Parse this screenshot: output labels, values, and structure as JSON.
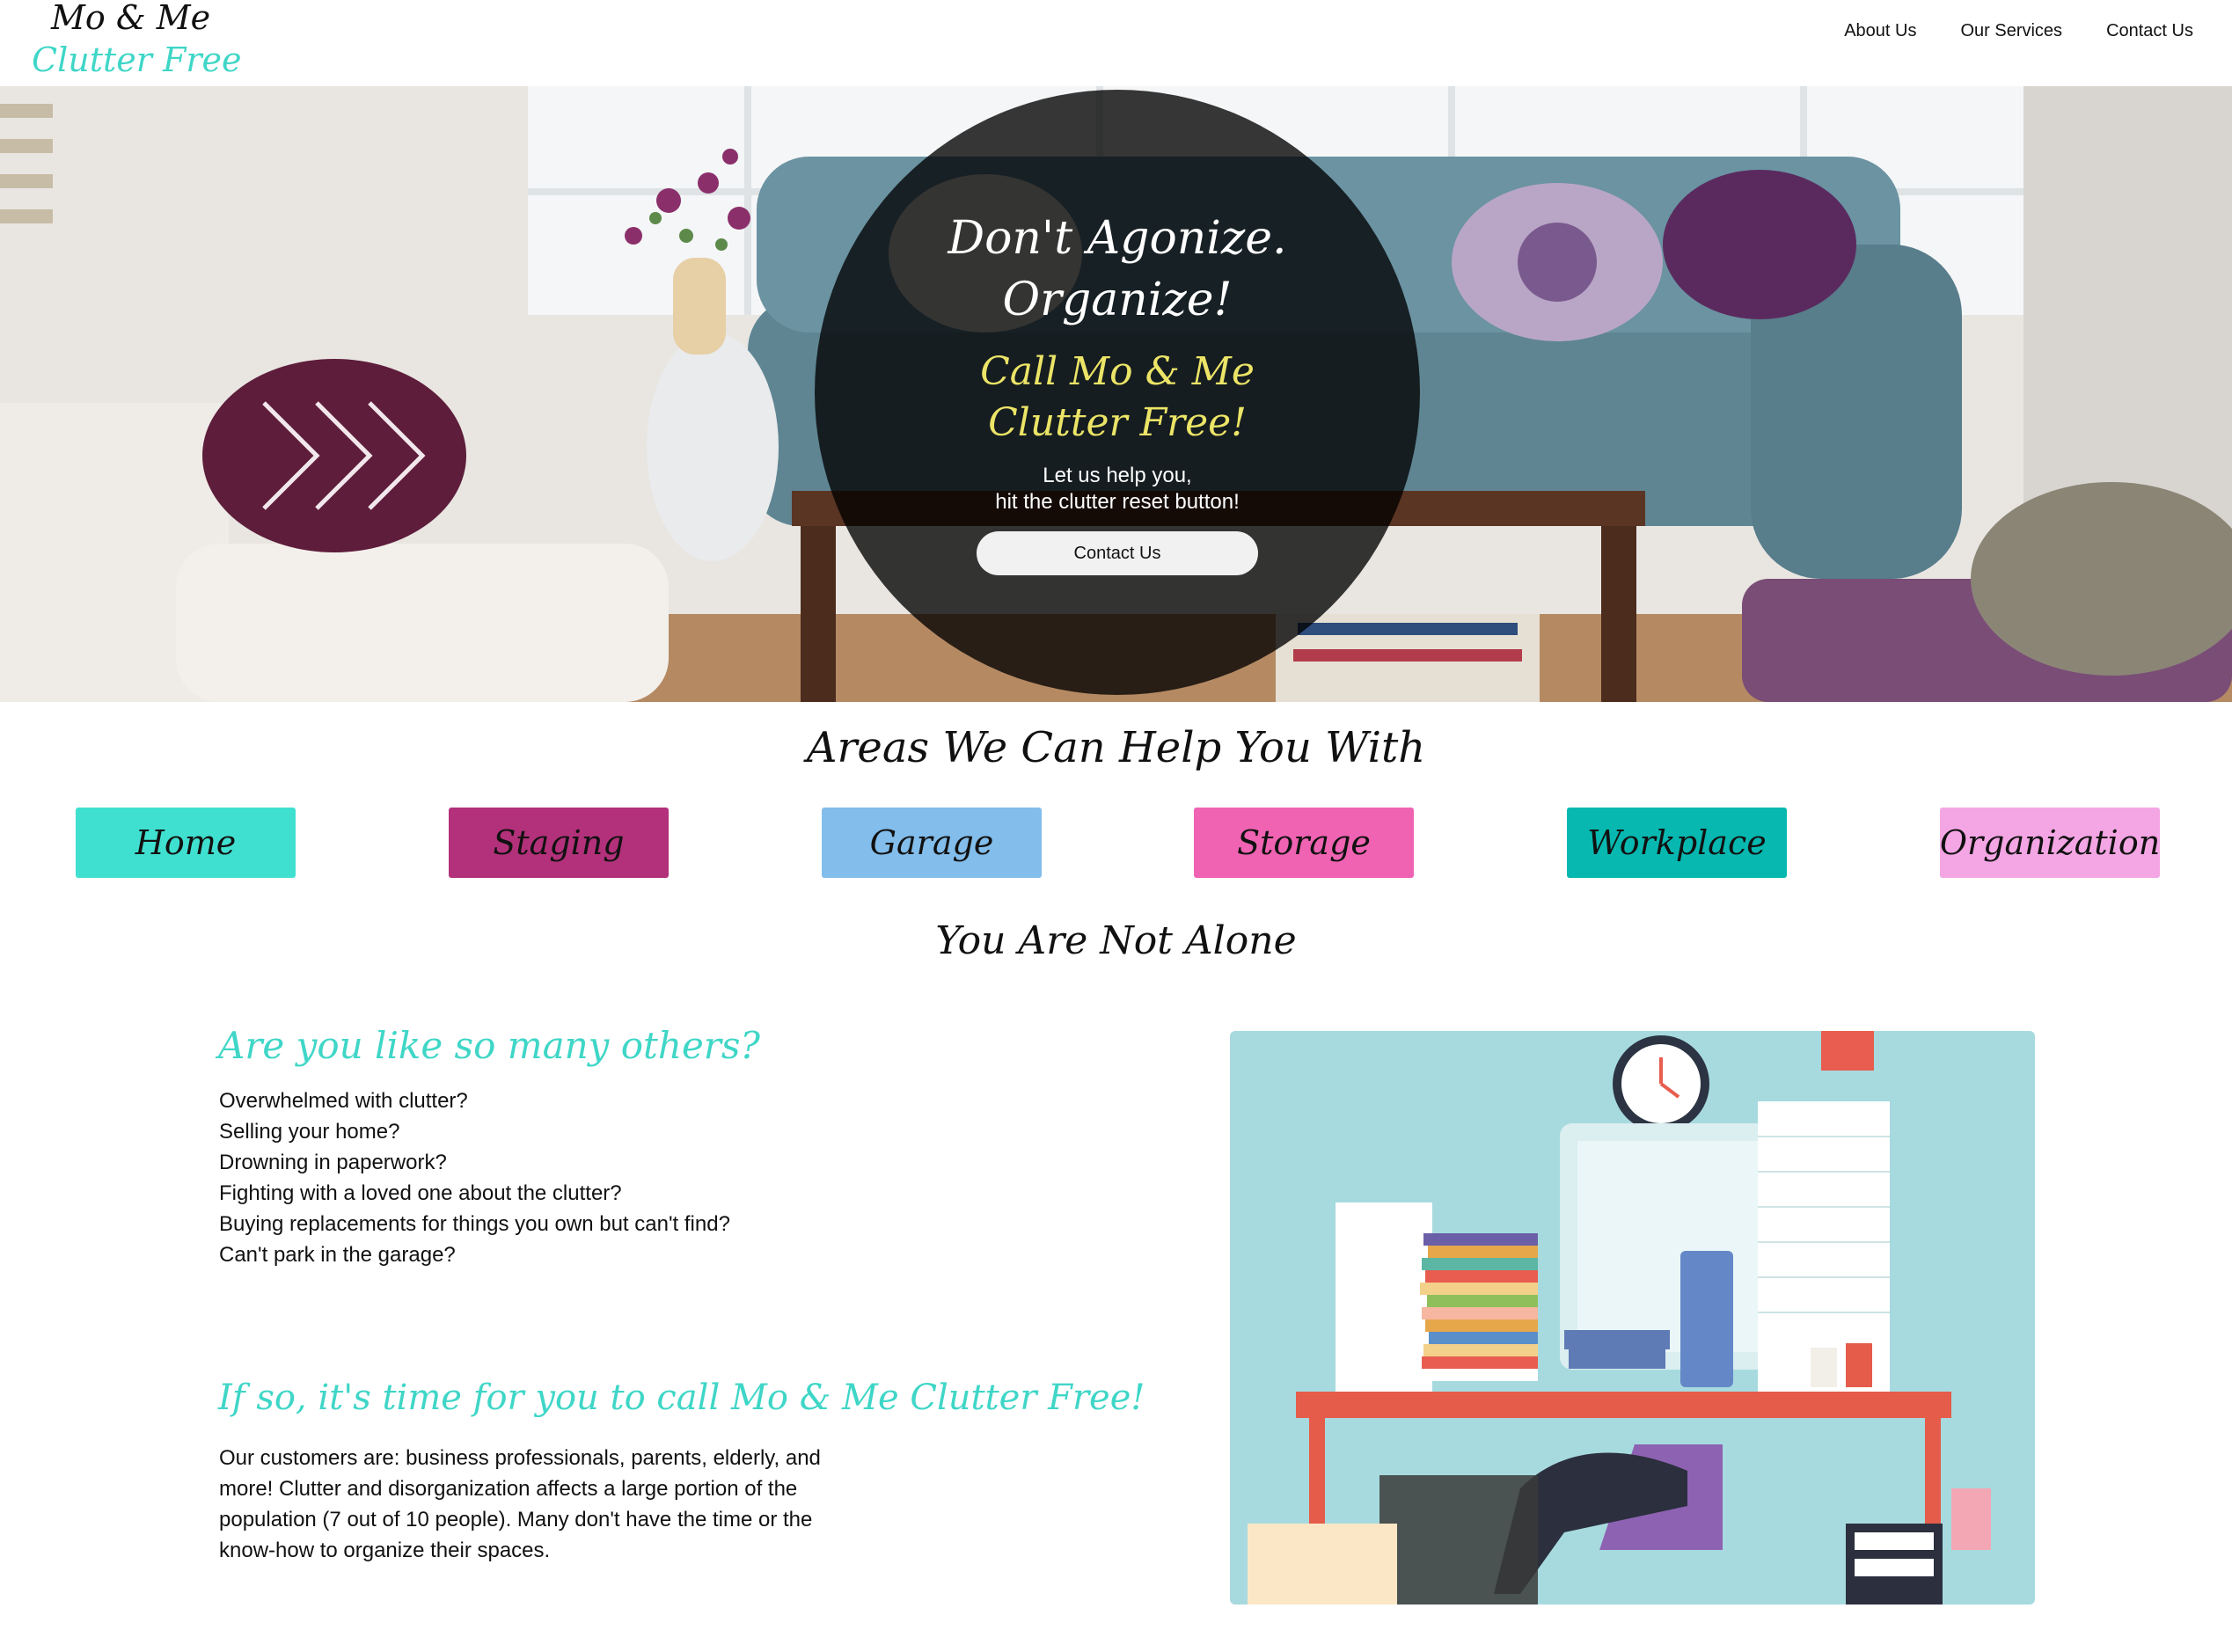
{
  "logo": {
    "line1": "Mo & Me",
    "line2": "Clutter Free"
  },
  "nav": {
    "items": [
      "About Us",
      "Our Services",
      "Contact Us"
    ]
  },
  "hero": {
    "title_line1": "Don't Agonize.",
    "title_line2": "Organize!",
    "call_line1": "Call Mo & Me",
    "call_line2": "Clutter Free!",
    "sub_line1": "Let us help you,",
    "sub_line2": "hit the clutter reset button!",
    "button_label": "Contact Us"
  },
  "areas": {
    "title": "Areas We Can Help You With",
    "items": [
      {
        "label": "Home",
        "color": "#40e0d0"
      },
      {
        "label": "Staging",
        "color": "#b2317a"
      },
      {
        "label": "Garage",
        "color": "#82bdeb"
      },
      {
        "label": "Storage",
        "color": "#ef63b2"
      },
      {
        "label": "Workplace",
        "color": "#07b8b0"
      },
      {
        "label": "Organization",
        "color": "#f4a6e4"
      }
    ]
  },
  "alone": {
    "title": "You Are Not Alone",
    "question_heading": "Are you like so many others?",
    "questions": [
      "Overwhelmed with clutter?",
      "Selling your home?",
      "Drowning in paperwork?",
      "Fighting with a loved one about the clutter?",
      "Buying replacements for things you own but can't find?",
      "Can't park in the garage?"
    ],
    "cta_heading": "If so, it's time for you to call Mo & Me Clutter Free!",
    "cta_text": "Our customers are: business professionals, parents, elderly, and more! Clutter and disorganization affects a large portion of the population (7 out of 10 people). Many don't have the time or the know-how to organize their spaces."
  },
  "colors": {
    "accent": "#3fd6c7",
    "hero_yellow": "#ece467"
  }
}
